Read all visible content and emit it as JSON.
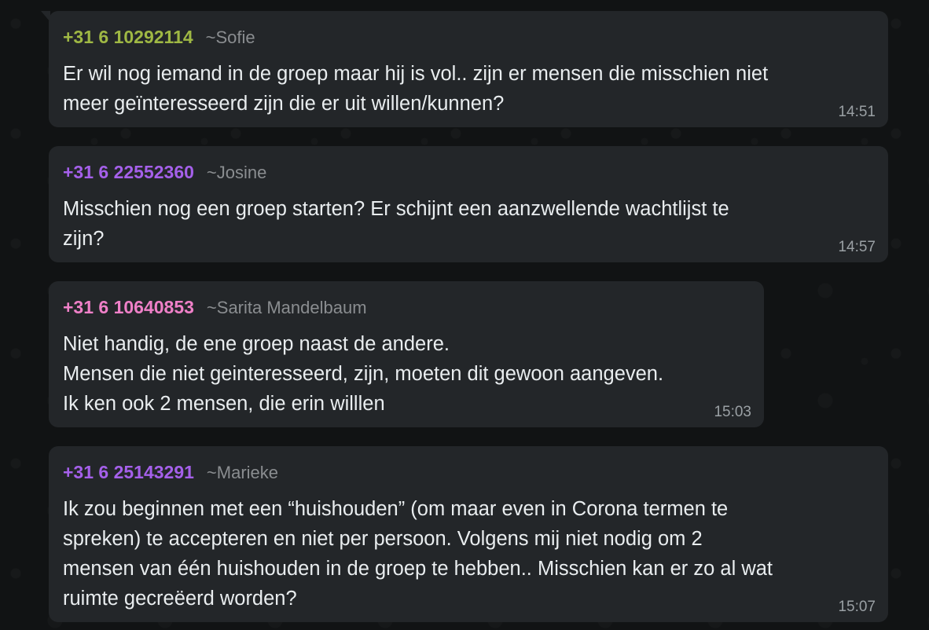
{
  "messages": [
    {
      "phone": "+31 6 10292114",
      "name": "~Sofie",
      "color": "#9fb844",
      "text": "Er wil nog iemand in de groep maar hij is vol.. zijn er mensen die misschien niet\nmeer geïnteresseerd zijn die er uit willen/kunnen?",
      "time": "14:51"
    },
    {
      "phone": "+31 6 22552360",
      "name": "~Josine",
      "color": "#a560ea",
      "text": "Misschien nog een groep starten? Er schijnt een aanzwellende wachtlijst te\nzijn?",
      "time": "14:57"
    },
    {
      "phone": "+31 6 10640853",
      "name": "~Sarita Mandelbaum",
      "color": "#ef80c8",
      "text": "Niet handig, de ene groep naast de andere.\nMensen die niet geinteresseerd, zijn, moeten dit gewoon aangeven.\nIk ken ook 2 mensen, die erin willlen",
      "time": "15:03"
    },
    {
      "phone": "+31 6 25143291",
      "name": "~Marieke",
      "color": "#a560ea",
      "text": "Ik zou beginnen met een “huishouden” (om maar even in Corona termen te\nspreken) te accepteren en niet per persoon. Volgens mij niet nodig om 2\nmensen van één huishouden in de groep te hebben.. Misschien kan er zo al wat\nruimte gecreëerd worden?",
      "time": "15:07"
    }
  ]
}
